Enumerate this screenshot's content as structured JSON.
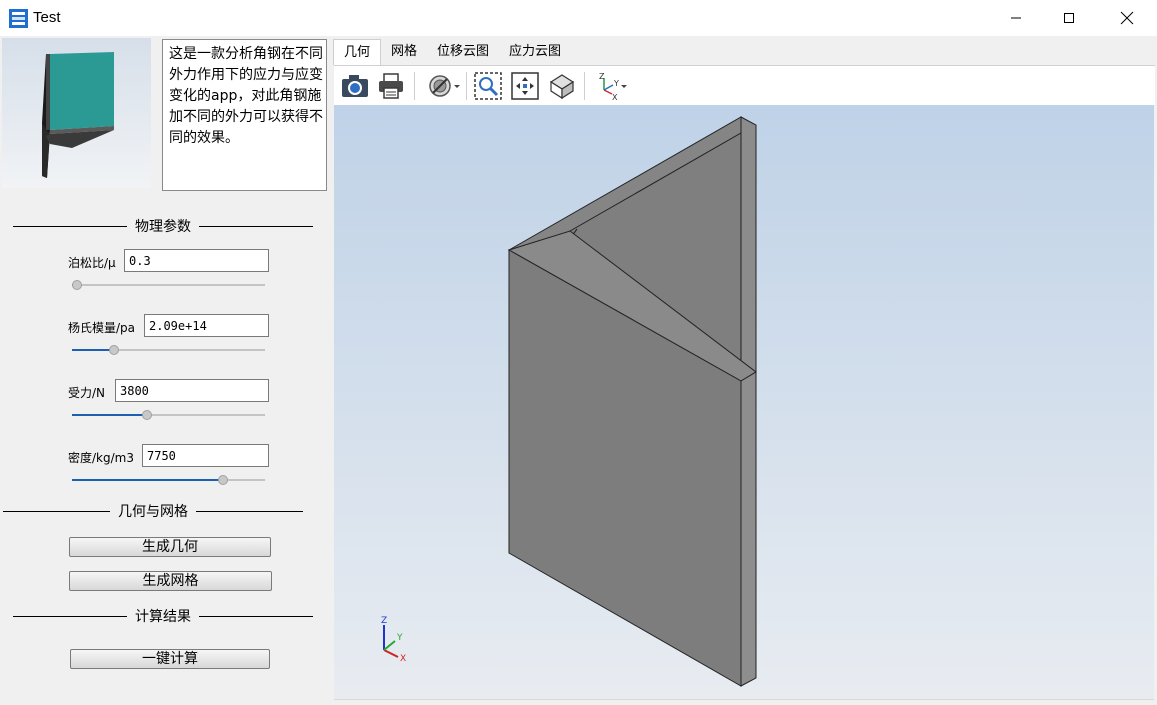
{
  "window": {
    "title": "Test"
  },
  "description": "这是一款分析角钢在不同外力作用下的应力与应变变化的app，对此角钢施加不同的外力可以获得不同的效果。",
  "sections": {
    "params": "物理参数",
    "geometry": "几何与网格",
    "results": "计算结果"
  },
  "params": [
    {
      "label": "泊松比/μ",
      "value": "0.3",
      "level": 0.0
    },
    {
      "label": "杨氏模量/pa",
      "value": "2.09e+14",
      "level": 0.2
    },
    {
      "label": "受力/N",
      "value": "3800",
      "level": 0.38
    },
    {
      "label": "密度/kg/m3",
      "value": "7750",
      "level": 0.8
    }
  ],
  "buttons": {
    "gen_geometry": "生成几何",
    "gen_mesh": "生成网格",
    "compute": "一键计算"
  },
  "tabs": [
    {
      "label": "几何",
      "active": true
    },
    {
      "label": "网格",
      "active": false
    },
    {
      "label": "位移云图",
      "active": false
    },
    {
      "label": "应力云图",
      "active": false
    }
  ],
  "toolbar": [
    "camera-icon",
    "print-icon",
    "display-mode-icon",
    "zoom-window-icon",
    "fit-all-icon",
    "iso-view-icon",
    "axes-orientation-icon"
  ],
  "axes": {
    "x": "X",
    "y": "Y",
    "z": "Z"
  },
  "colors": {
    "model": "#7d7d7d",
    "thumb_face": "#2b9a95",
    "accent": "#1d5fb0"
  }
}
